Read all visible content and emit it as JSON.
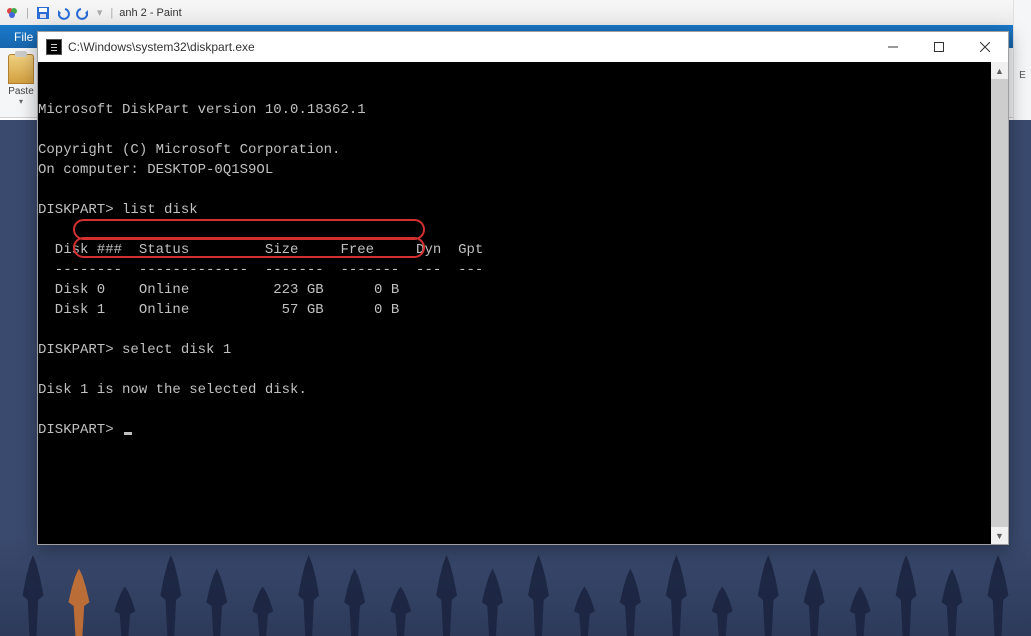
{
  "paint": {
    "qat_title": "anh 2 - Paint",
    "file_tab": "File",
    "paste_label": "Paste",
    "right_label": "E"
  },
  "cmd": {
    "title_path": "C:\\Windows\\system32\\diskpart.exe",
    "lines": {
      "version": "Microsoft DiskPart version 10.0.18362.1",
      "copyright": "Copyright (C) Microsoft Corporation.",
      "computer": "On computer: DESKTOP-0Q1S9OL",
      "prompt1": "DISKPART> list disk",
      "header": "  Disk ###  Status         Size     Free     Dyn  Gpt",
      "divider": "  --------  -------------  -------  -------  ---  ---",
      "disk0": "  Disk 0    Online          223 GB      0 B",
      "disk1": "  Disk 1    Online           57 GB      0 B",
      "prompt2": "DISKPART> select disk 1",
      "selected": "Disk 1 is now the selected disk.",
      "prompt3": "DISKPART> "
    }
  }
}
